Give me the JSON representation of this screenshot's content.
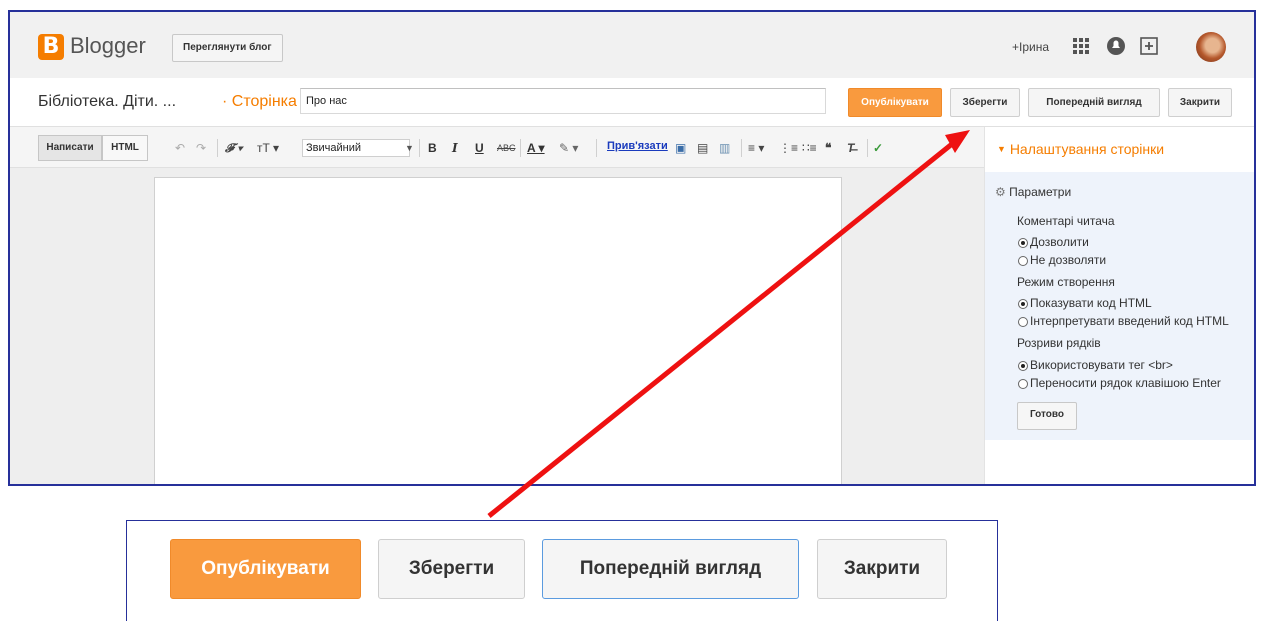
{
  "header": {
    "logo_letter": "B",
    "app_name": "Blogger",
    "view_blog_label": "Переглянути блог",
    "user_name": "+Ірина"
  },
  "titlebar": {
    "blog_name": "Бібліотека. Діти. ...",
    "page_type": "· Сторінка",
    "page_title_value": "Про нас",
    "publish_label": "Опублікувати",
    "save_label": "Зберегти",
    "preview_label": "Попередній вигляд",
    "close_label": "Закрити"
  },
  "toolbar": {
    "compose_label": "Написати",
    "html_label": "HTML",
    "font_size_value": "Звичайний",
    "link_label": "Прив'язати"
  },
  "sidebar": {
    "title": "Налаштування сторінки",
    "section_label": "Параметри",
    "comments_label": "Коментарі читача",
    "comments_allow": "Дозволити",
    "comments_deny": "Не дозволяти",
    "compose_mode_label": "Режим створення",
    "mode_show_html": "Показувати код HTML",
    "mode_interpret_html": "Інтерпретувати введений код HTML",
    "line_breaks_label": "Розриви рядків",
    "breaks_use_br": "Використовувати тег <br>",
    "breaks_enter": "Переносити рядок клавішою Enter",
    "done_label": "Готово"
  },
  "zoom": {
    "publish_label": "Опублікувати",
    "save_label": "Зберегти",
    "preview_label": "Попередній вигляд",
    "close_label": "Закрити"
  },
  "colors": {
    "brand_orange": "#f57d00",
    "publish_button": "#f99a3e",
    "arrow": "#ee1111",
    "frame_border": "#26309a"
  },
  "icons": [
    "apps-grid-icon",
    "notifications-icon",
    "share-plus-icon",
    "undo-icon",
    "redo-icon",
    "font-family-icon",
    "font-size-icon",
    "bold-icon",
    "italic-icon",
    "underline-icon",
    "strikethrough-icon",
    "text-color-icon",
    "highlight-icon",
    "image-icon",
    "video-icon",
    "jump-break-icon",
    "align-icon",
    "numbered-list-icon",
    "bullet-list-icon",
    "quote-icon",
    "clear-format-icon",
    "spellcheck-icon",
    "gear-icon",
    "arrow-annotation"
  ]
}
